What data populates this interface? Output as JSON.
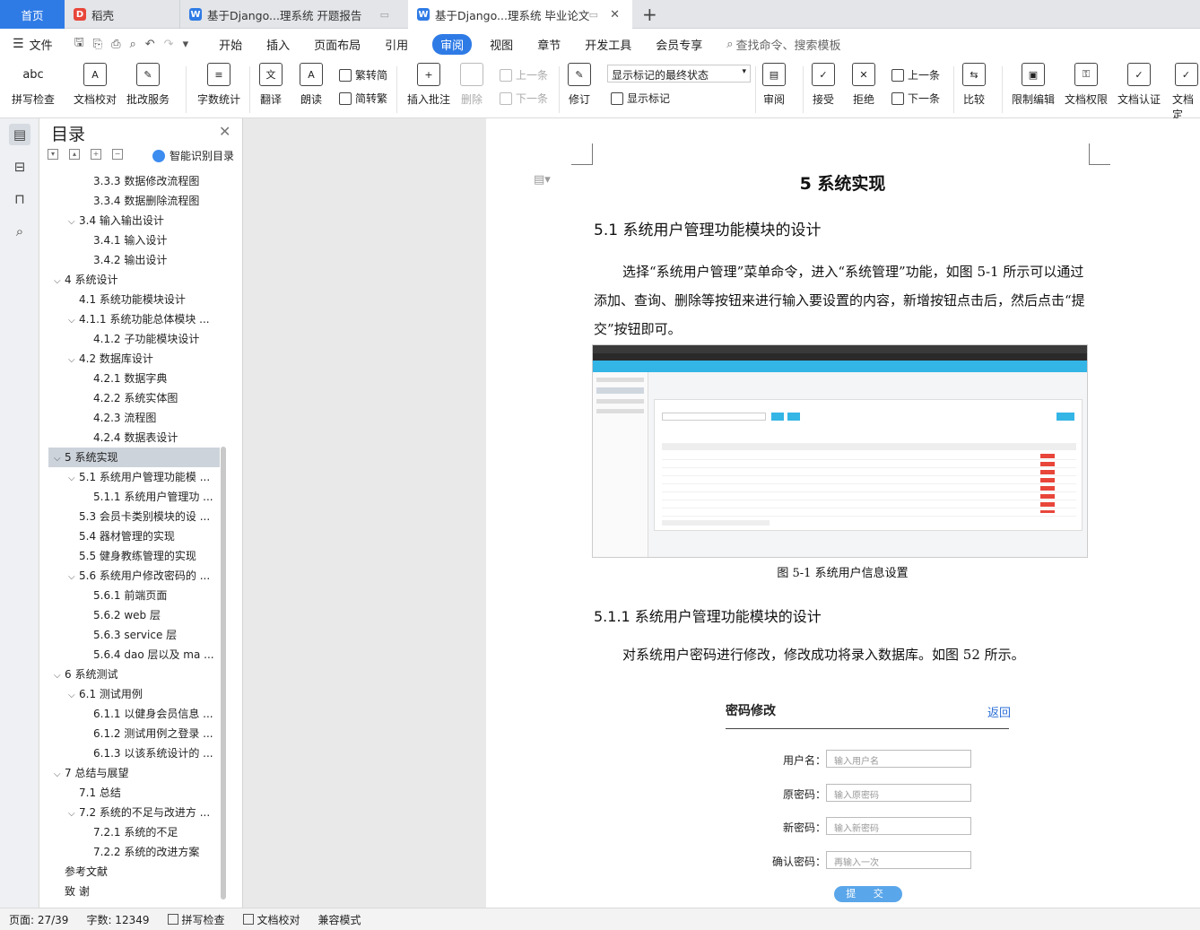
{
  "tabs": {
    "home": "首页",
    "t1": "稻壳",
    "t2": "基于Django...理系统 开题报告",
    "t3": "基于Django...理系统 毕业论文"
  },
  "menu": {
    "file": "文件",
    "items": [
      "开始",
      "插入",
      "页面布局",
      "引用",
      "审阅",
      "视图",
      "章节",
      "开发工具",
      "会员专享"
    ],
    "search": "查找命令、搜索模板"
  },
  "ribbon": {
    "spell": "拼写检查",
    "proof": "文档校对",
    "batch": "批改服务",
    "wordcount": "字数统计",
    "translate": "翻译",
    "read": "朗读",
    "t2s": "繁转简",
    "s2t": "简转繁",
    "comment": "插入批注",
    "delete": "删除",
    "prev": "上一条",
    "next": "下一条",
    "revise": "修订",
    "markup_select": "显示标记的最终状态",
    "show_markup": "显示标记",
    "review": "审阅",
    "accept": "接受",
    "reject": "拒绝",
    "prev2": "上一条",
    "next2": "下一条",
    "compare": "比较",
    "restrict": "限制编辑",
    "permission": "文档权限",
    "cert": "文档认证",
    "doc_more": "文档定"
  },
  "toc": {
    "title": "目录",
    "smart": "智能识别目录",
    "items": [
      {
        "t": "3.3.3 数据修改流程图",
        "l": 3
      },
      {
        "t": "3.3.4 数据删除流程图",
        "l": 3
      },
      {
        "t": "3.4 输入输出设计",
        "l": 2,
        "c": true
      },
      {
        "t": "3.4.1 输入设计",
        "l": 3
      },
      {
        "t": "3.4.2 输出设计",
        "l": 3
      },
      {
        "t": "4  系统设计",
        "l": 1,
        "c": true
      },
      {
        "t": "4.1 系统功能模块设计",
        "l": 2
      },
      {
        "t": "4.1.1 系统功能总体模块 ...",
        "l": 2,
        "c": true
      },
      {
        "t": "4.1.2 子功能模块设计",
        "l": 3
      },
      {
        "t": "4.2 数据库设计",
        "l": 2,
        "c": true
      },
      {
        "t": "4.2.1 数据字典",
        "l": 3
      },
      {
        "t": "4.2.2 系统实体图",
        "l": 3
      },
      {
        "t": "4.2.3 流程图",
        "l": 3
      },
      {
        "t": "4.2.4 数据表设计",
        "l": 3
      },
      {
        "t": "5  系统实现",
        "l": 1,
        "c": true,
        "sel": true
      },
      {
        "t": "5.1 系统用户管理功能模 ...",
        "l": 2,
        "c": true
      },
      {
        "t": "5.1.1 系统用户管理功 ...",
        "l": 3
      },
      {
        "t": "5.3 会员卡类别模块的设 ...",
        "l": 2
      },
      {
        "t": "5.4 器材管理的实现",
        "l": 2
      },
      {
        "t": "5.5 健身教练管理的实现",
        "l": 2
      },
      {
        "t": "5.6 系统用户修改密码的 ...",
        "l": 2,
        "c": true
      },
      {
        "t": "5.6.1  前端页面",
        "l": 3
      },
      {
        "t": "5.6.2 web 层",
        "l": 3
      },
      {
        "t": "5.6.3 service 层",
        "l": 3
      },
      {
        "t": "5.6.4 dao 层以及 ma ...",
        "l": 3
      },
      {
        "t": "6  系统测试",
        "l": 1,
        "c": true
      },
      {
        "t": "6.1 测试用例",
        "l": 2,
        "c": true
      },
      {
        "t": "6.1.1  以健身会员信息 ...",
        "l": 3
      },
      {
        "t": "6.1.2  测试用例之登录 ...",
        "l": 3
      },
      {
        "t": "6.1.3  以该系统设计的 ...",
        "l": 3
      },
      {
        "t": "7  总结与展望",
        "l": 1,
        "c": true
      },
      {
        "t": "7.1  总结",
        "l": 2
      },
      {
        "t": "7.2 系统的不足与改进方 ...",
        "l": 2,
        "c": true
      },
      {
        "t": "7.2.1  系统的不足",
        "l": 3
      },
      {
        "t": "7.2.2  系统的改进方案",
        "l": 3
      },
      {
        "t": "参考文献",
        "l": 1
      },
      {
        "t": "致   谢",
        "l": 1
      }
    ]
  },
  "doc": {
    "chapter": "5  系统实现",
    "h2": "5.1 系统用户管理功能模块的设计",
    "para1": "选择“系统用户管理”菜单命令，进入“系统管理”功能，如图 5-1 所示可以通过添加、查询、删除等按钮来进行输入要设置的内容，新增按钮点击后，然后点击“提交”按钮即可。",
    "fig1_caption": "图 5-1  系统用户信息设置",
    "h3": "5.1.1 系统用户管理功能模块的设计",
    "para2": "对系统用户密码进行修改，修改成功将录入数据库。如图 52 所示。",
    "form": {
      "title": "密码修改",
      "back": "返回",
      "username_label": "用户名：",
      "username_ph": "输入用户名",
      "old_label": "原密码：",
      "old_ph": "输入原密码",
      "new_label": "新密码：",
      "new_ph": "输入新密码",
      "confirm_label": "确认密码：",
      "confirm_ph": "再输入一次",
      "submit": "提 交"
    }
  },
  "status": {
    "page": "页面: 27/39",
    "words": "字数: 12349",
    "spell": "拼写检查",
    "proof": "文档校对",
    "compat": "兼容模式"
  },
  "colors": {
    "accent": "#2f7be6",
    "fig_header": "#33b5e5"
  }
}
